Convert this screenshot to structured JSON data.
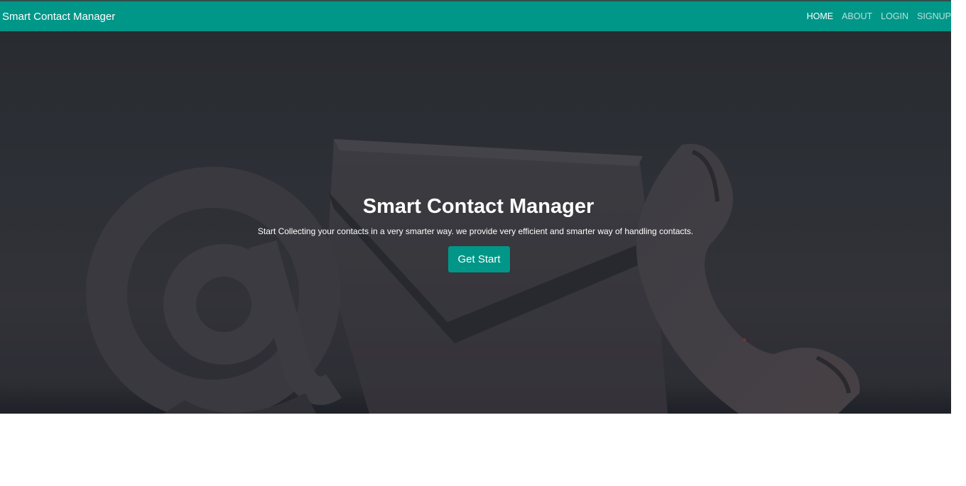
{
  "navbar": {
    "brand": "Smart Contact Manager",
    "links": [
      {
        "label": "HOME",
        "active": true
      },
      {
        "label": "ABOUT",
        "active": false
      },
      {
        "label": "LOGIN",
        "active": false
      },
      {
        "label": "SIGNUP",
        "active": false
      }
    ]
  },
  "hero": {
    "title": "Smart Contact Manager",
    "subtitle": "Start Collecting your contacts in a very smarter way. we provide very efficient and smarter way of handling contacts.",
    "cta_label": "Get Start",
    "background_icons": [
      "at-sign-icon",
      "envelope-icon",
      "phone-handset-icon"
    ]
  },
  "colors": {
    "primary": "#009688",
    "hero_overlay": "#2c3034",
    "text_light": "#ffffff"
  }
}
